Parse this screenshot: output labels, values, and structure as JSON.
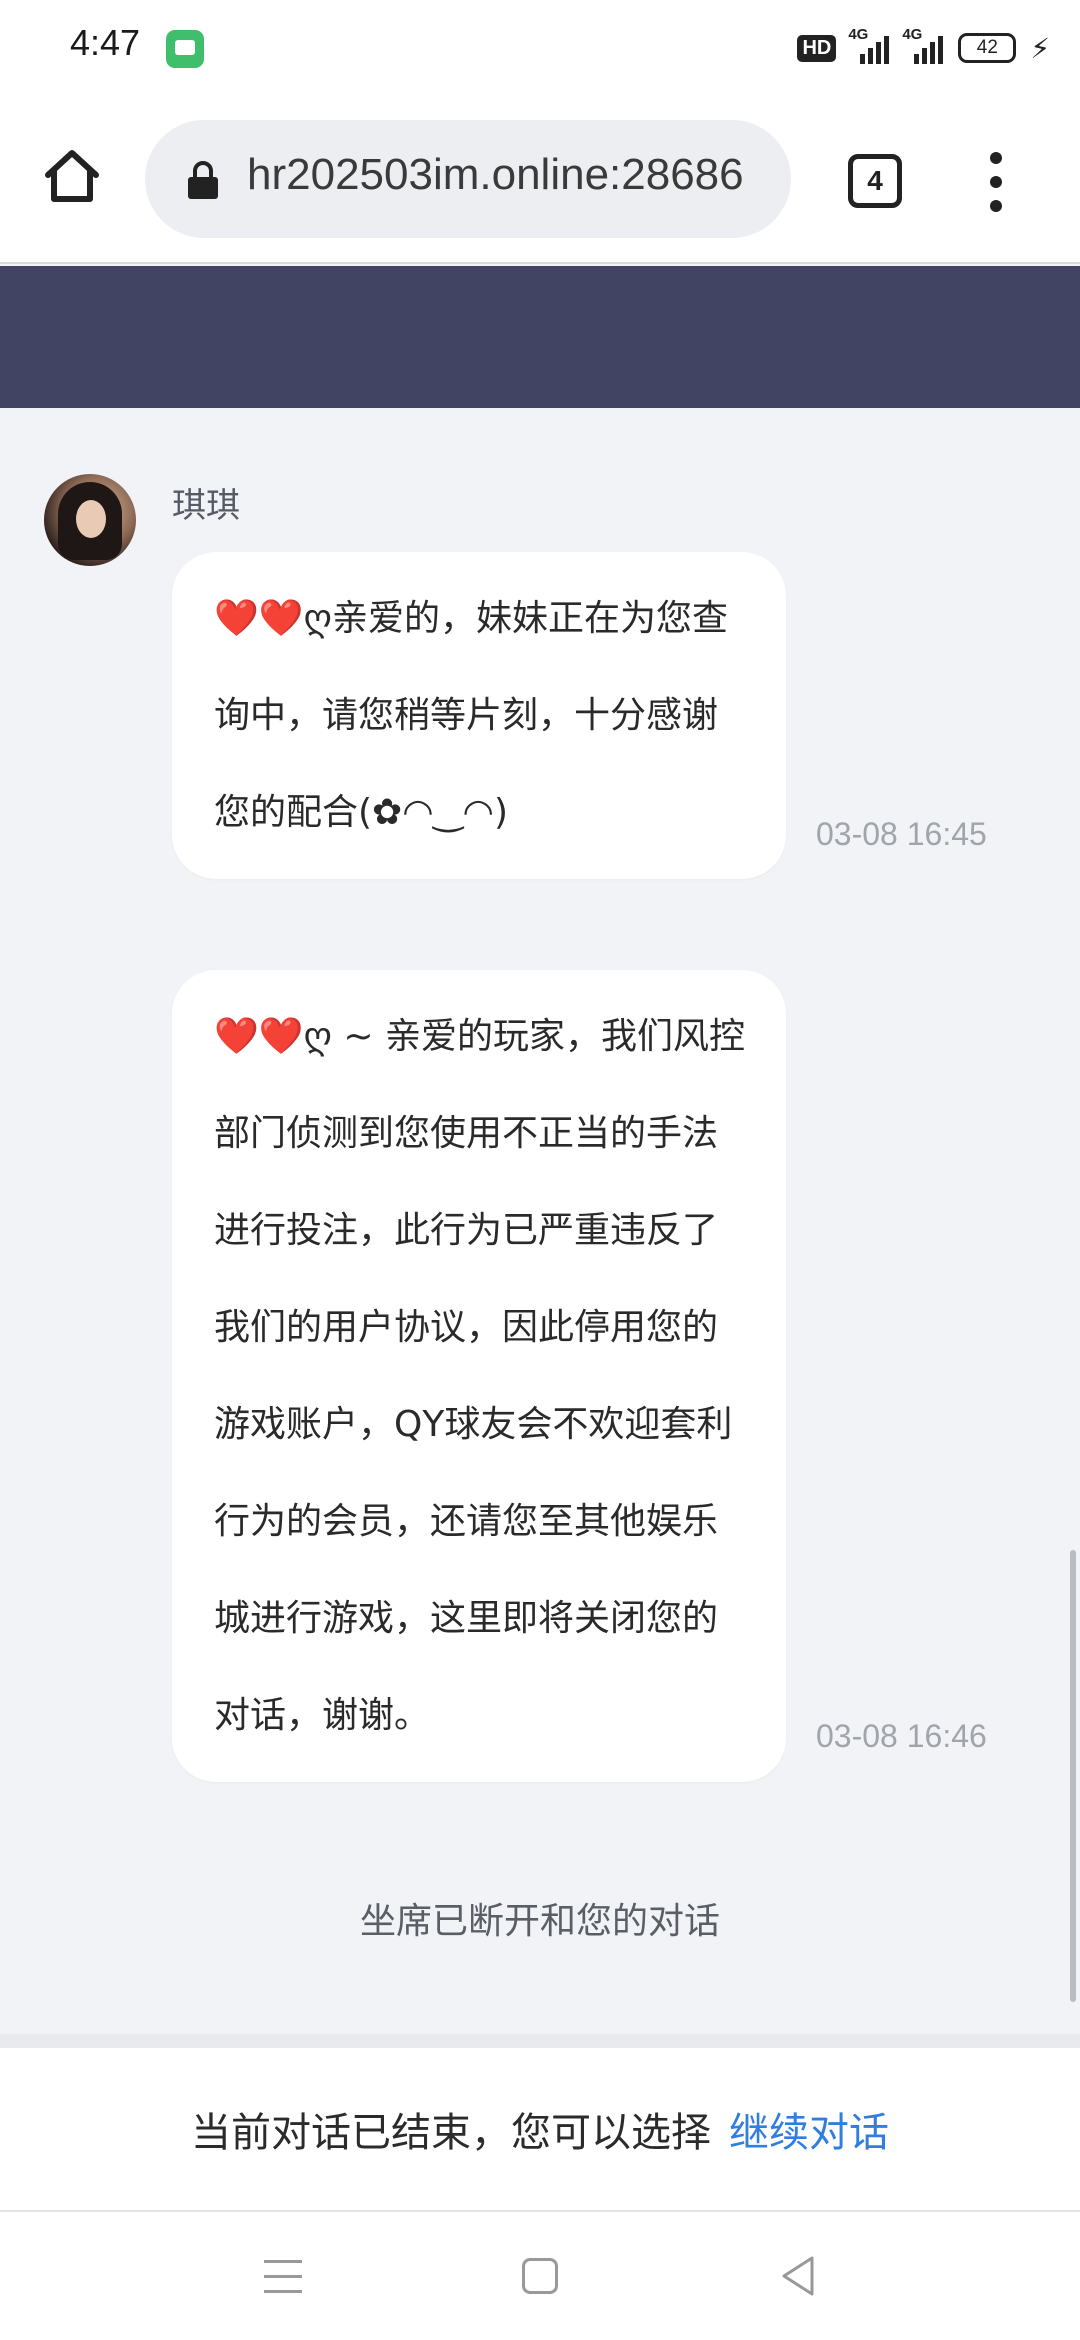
{
  "status_bar": {
    "time": "4:47",
    "hd_badge": "HD",
    "signal_1_label": "4G",
    "signal_2_label": "4G",
    "battery": "42"
  },
  "browser": {
    "url": "hr202503im.online:28686",
    "tab_count": "4"
  },
  "chat": {
    "agent_name": "琪琪",
    "messages": [
      {
        "text": "❤️❤️ღ亲爱的，妹妹正在为您查询中，请您稍等片刻，十分感谢您的配合(✿◠‿◠)",
        "time": "03-08 16:45"
      },
      {
        "text": "❤️❤️ღ ~ 亲爱的玩家，我们风控部门侦测到您使用不正当的手法进行投注，此行为已严重违反了我们的用户协议，因此停用您的游戏账户，QY球友会不欢迎套利行为的会员，还请您至其他娱乐城进行游戏，这里即将关闭您的对话，谢谢。",
        "time": "03-08 16:46"
      }
    ],
    "system_notice": "坐席已断开和您的对话"
  },
  "footer": {
    "ended_text": "当前对话已结束，您可以选择",
    "continue_label": "继续对话"
  },
  "colors": {
    "header": "#424464",
    "chat_bg": "#f1f3f7",
    "link": "#2f7ee0"
  }
}
